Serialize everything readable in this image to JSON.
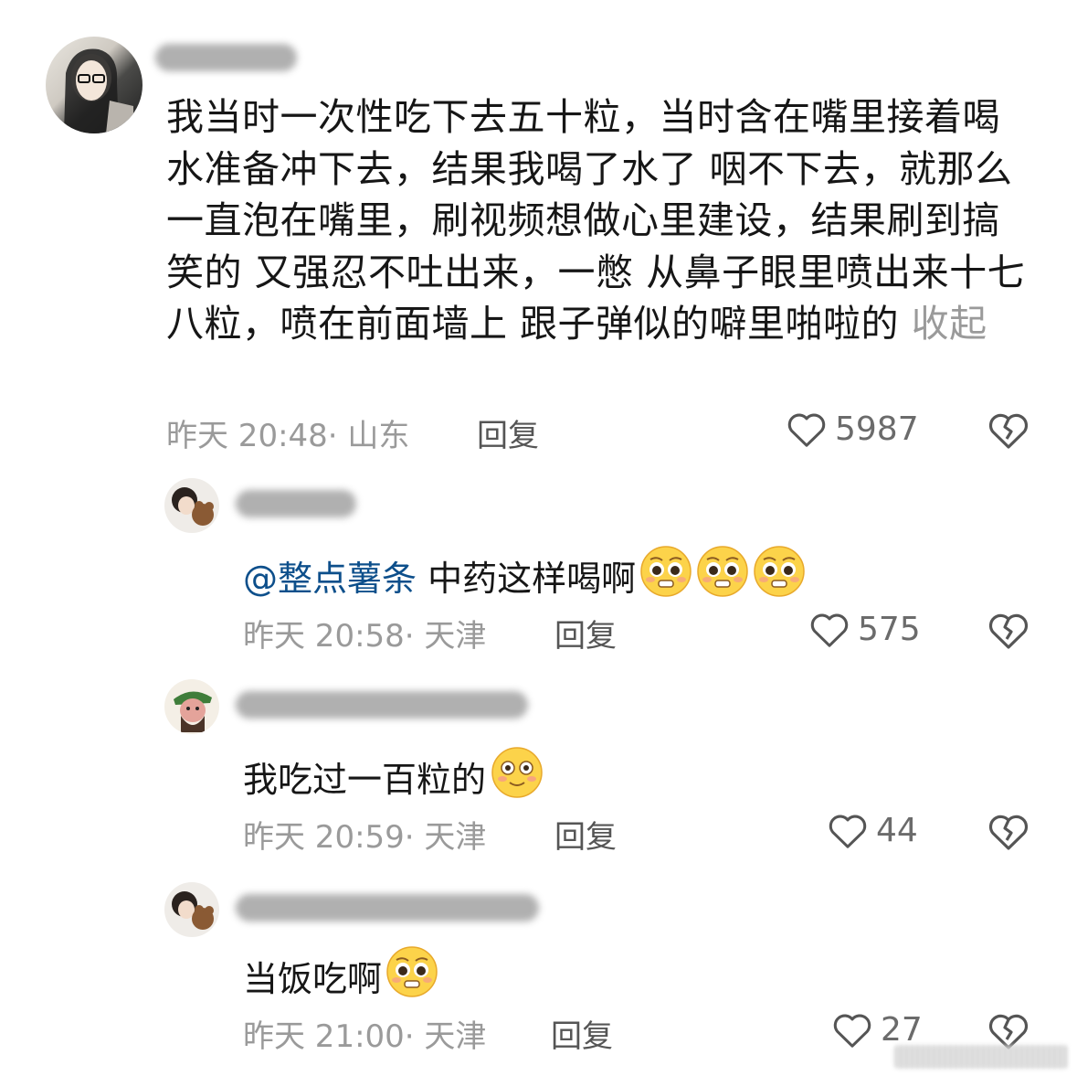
{
  "comments": [
    {
      "text": "我当时一次性吃下去五十粒，当时含在嘴里接着喝水准备冲下去，结果我喝了水了 咽不下去，就那么一直泡在嘴里，刷视频想做心里建设，结果刷到搞笑的 又强忍不吐出来，一憋 从鼻子眼里喷出来十七八粒，喷在前面墙上 跟子弹似的噼里啪啦的",
      "collapse": "收起",
      "meta": "昨天 20:48· 山东",
      "reply": "回复",
      "likes": "5987"
    },
    {
      "mention": "@整点薯条",
      "text": " 中药这样喝啊",
      "meta": "昨天 20:58· 天津",
      "reply": "回复",
      "likes": "575"
    },
    {
      "text": "我吃过一百粒的",
      "meta": "昨天 20:59· 天津",
      "reply": "回复",
      "likes": "44"
    },
    {
      "text": "当饭吃啊",
      "meta": "昨天 21:00· 天津",
      "reply": "回复",
      "likes": "27"
    }
  ],
  "icons": {
    "like": "heart-outline-icon",
    "dislike": "broken-heart-icon",
    "emoji_pleading": "pleading-face-emoji",
    "emoji_flushed": "flushed-face-emoji"
  },
  "colors": {
    "mention": "#0d4f8b",
    "meta": "#9a9a9a",
    "emoji_yellow": "#fcd34a"
  }
}
